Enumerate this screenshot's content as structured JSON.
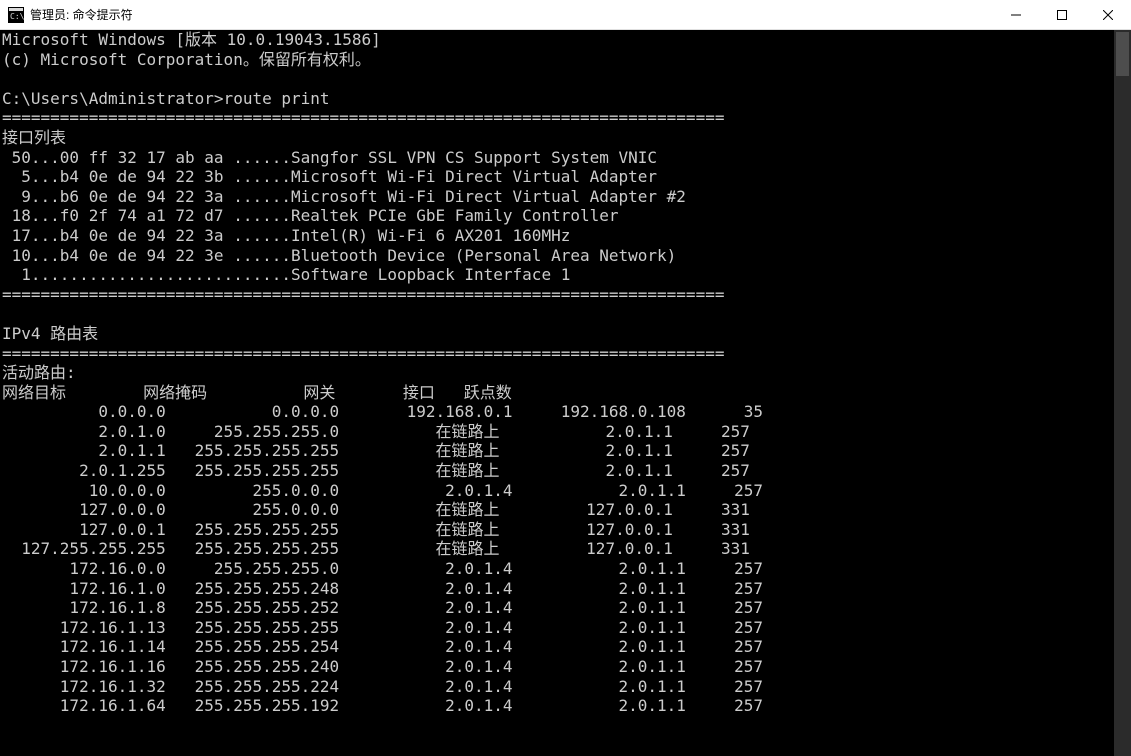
{
  "window": {
    "title": "管理员: 命令提示符"
  },
  "banner": {
    "line1": "Microsoft Windows [版本 10.0.19043.1586]",
    "line2": "(c) Microsoft Corporation。保留所有权利。"
  },
  "prompt": {
    "path": "C:\\Users\\Administrator>",
    "command": "route print"
  },
  "separator": "===========================================================================",
  "interfaces": {
    "heading": "接口列表",
    "rows": [
      {
        "idx": "50",
        "mac": "00 ff 32 17 ab aa",
        "desc": "Sangfor SSL VPN CS Support System VNIC"
      },
      {
        "idx": "5",
        "mac": "b4 0e de 94 22 3b",
        "desc": "Microsoft Wi-Fi Direct Virtual Adapter"
      },
      {
        "idx": "9",
        "mac": "b6 0e de 94 22 3a",
        "desc": "Microsoft Wi-Fi Direct Virtual Adapter #2"
      },
      {
        "idx": "18",
        "mac": "f0 2f 74 a1 72 d7",
        "desc": "Realtek PCIe GbE Family Controller"
      },
      {
        "idx": "17",
        "mac": "b4 0e de 94 22 3a",
        "desc": "Intel(R) Wi-Fi 6 AX201 160MHz"
      },
      {
        "idx": "10",
        "mac": "b4 0e de 94 22 3e",
        "desc": "Bluetooth Device (Personal Area Network)"
      },
      {
        "idx": "1",
        "mac": "",
        "desc": "Software Loopback Interface 1"
      }
    ]
  },
  "ipv4": {
    "heading": "IPv4 路由表",
    "active_heading": "活动路由:",
    "columns": {
      "dest": "网络目标",
      "mask": "网络掩码",
      "gateway": "网关",
      "iface": "接口",
      "metric": "跃点数"
    },
    "routes": [
      {
        "dest": "0.0.0.0",
        "mask": "0.0.0.0",
        "gateway": "192.168.0.1",
        "iface": "192.168.0.108",
        "metric": "35"
      },
      {
        "dest": "2.0.1.0",
        "mask": "255.255.255.0",
        "gateway": "在链路上",
        "iface": "2.0.1.1",
        "metric": "257"
      },
      {
        "dest": "2.0.1.1",
        "mask": "255.255.255.255",
        "gateway": "在链路上",
        "iface": "2.0.1.1",
        "metric": "257"
      },
      {
        "dest": "2.0.1.255",
        "mask": "255.255.255.255",
        "gateway": "在链路上",
        "iface": "2.0.1.1",
        "metric": "257"
      },
      {
        "dest": "10.0.0.0",
        "mask": "255.0.0.0",
        "gateway": "2.0.1.4",
        "iface": "2.0.1.1",
        "metric": "257"
      },
      {
        "dest": "127.0.0.0",
        "mask": "255.0.0.0",
        "gateway": "在链路上",
        "iface": "127.0.0.1",
        "metric": "331"
      },
      {
        "dest": "127.0.0.1",
        "mask": "255.255.255.255",
        "gateway": "在链路上",
        "iface": "127.0.0.1",
        "metric": "331"
      },
      {
        "dest": "127.255.255.255",
        "mask": "255.255.255.255",
        "gateway": "在链路上",
        "iface": "127.0.0.1",
        "metric": "331"
      },
      {
        "dest": "172.16.0.0",
        "mask": "255.255.255.0",
        "gateway": "2.0.1.4",
        "iface": "2.0.1.1",
        "metric": "257"
      },
      {
        "dest": "172.16.1.0",
        "mask": "255.255.255.248",
        "gateway": "2.0.1.4",
        "iface": "2.0.1.1",
        "metric": "257"
      },
      {
        "dest": "172.16.1.8",
        "mask": "255.255.255.252",
        "gateway": "2.0.1.4",
        "iface": "2.0.1.1",
        "metric": "257"
      },
      {
        "dest": "172.16.1.13",
        "mask": "255.255.255.255",
        "gateway": "2.0.1.4",
        "iface": "2.0.1.1",
        "metric": "257"
      },
      {
        "dest": "172.16.1.14",
        "mask": "255.255.255.254",
        "gateway": "2.0.1.4",
        "iface": "2.0.1.1",
        "metric": "257"
      },
      {
        "dest": "172.16.1.16",
        "mask": "255.255.255.240",
        "gateway": "2.0.1.4",
        "iface": "2.0.1.1",
        "metric": "257"
      },
      {
        "dest": "172.16.1.32",
        "mask": "255.255.255.224",
        "gateway": "2.0.1.4",
        "iface": "2.0.1.1",
        "metric": "257"
      },
      {
        "dest": "172.16.1.64",
        "mask": "255.255.255.192",
        "gateway": "2.0.1.4",
        "iface": "2.0.1.1",
        "metric": "257"
      }
    ]
  }
}
